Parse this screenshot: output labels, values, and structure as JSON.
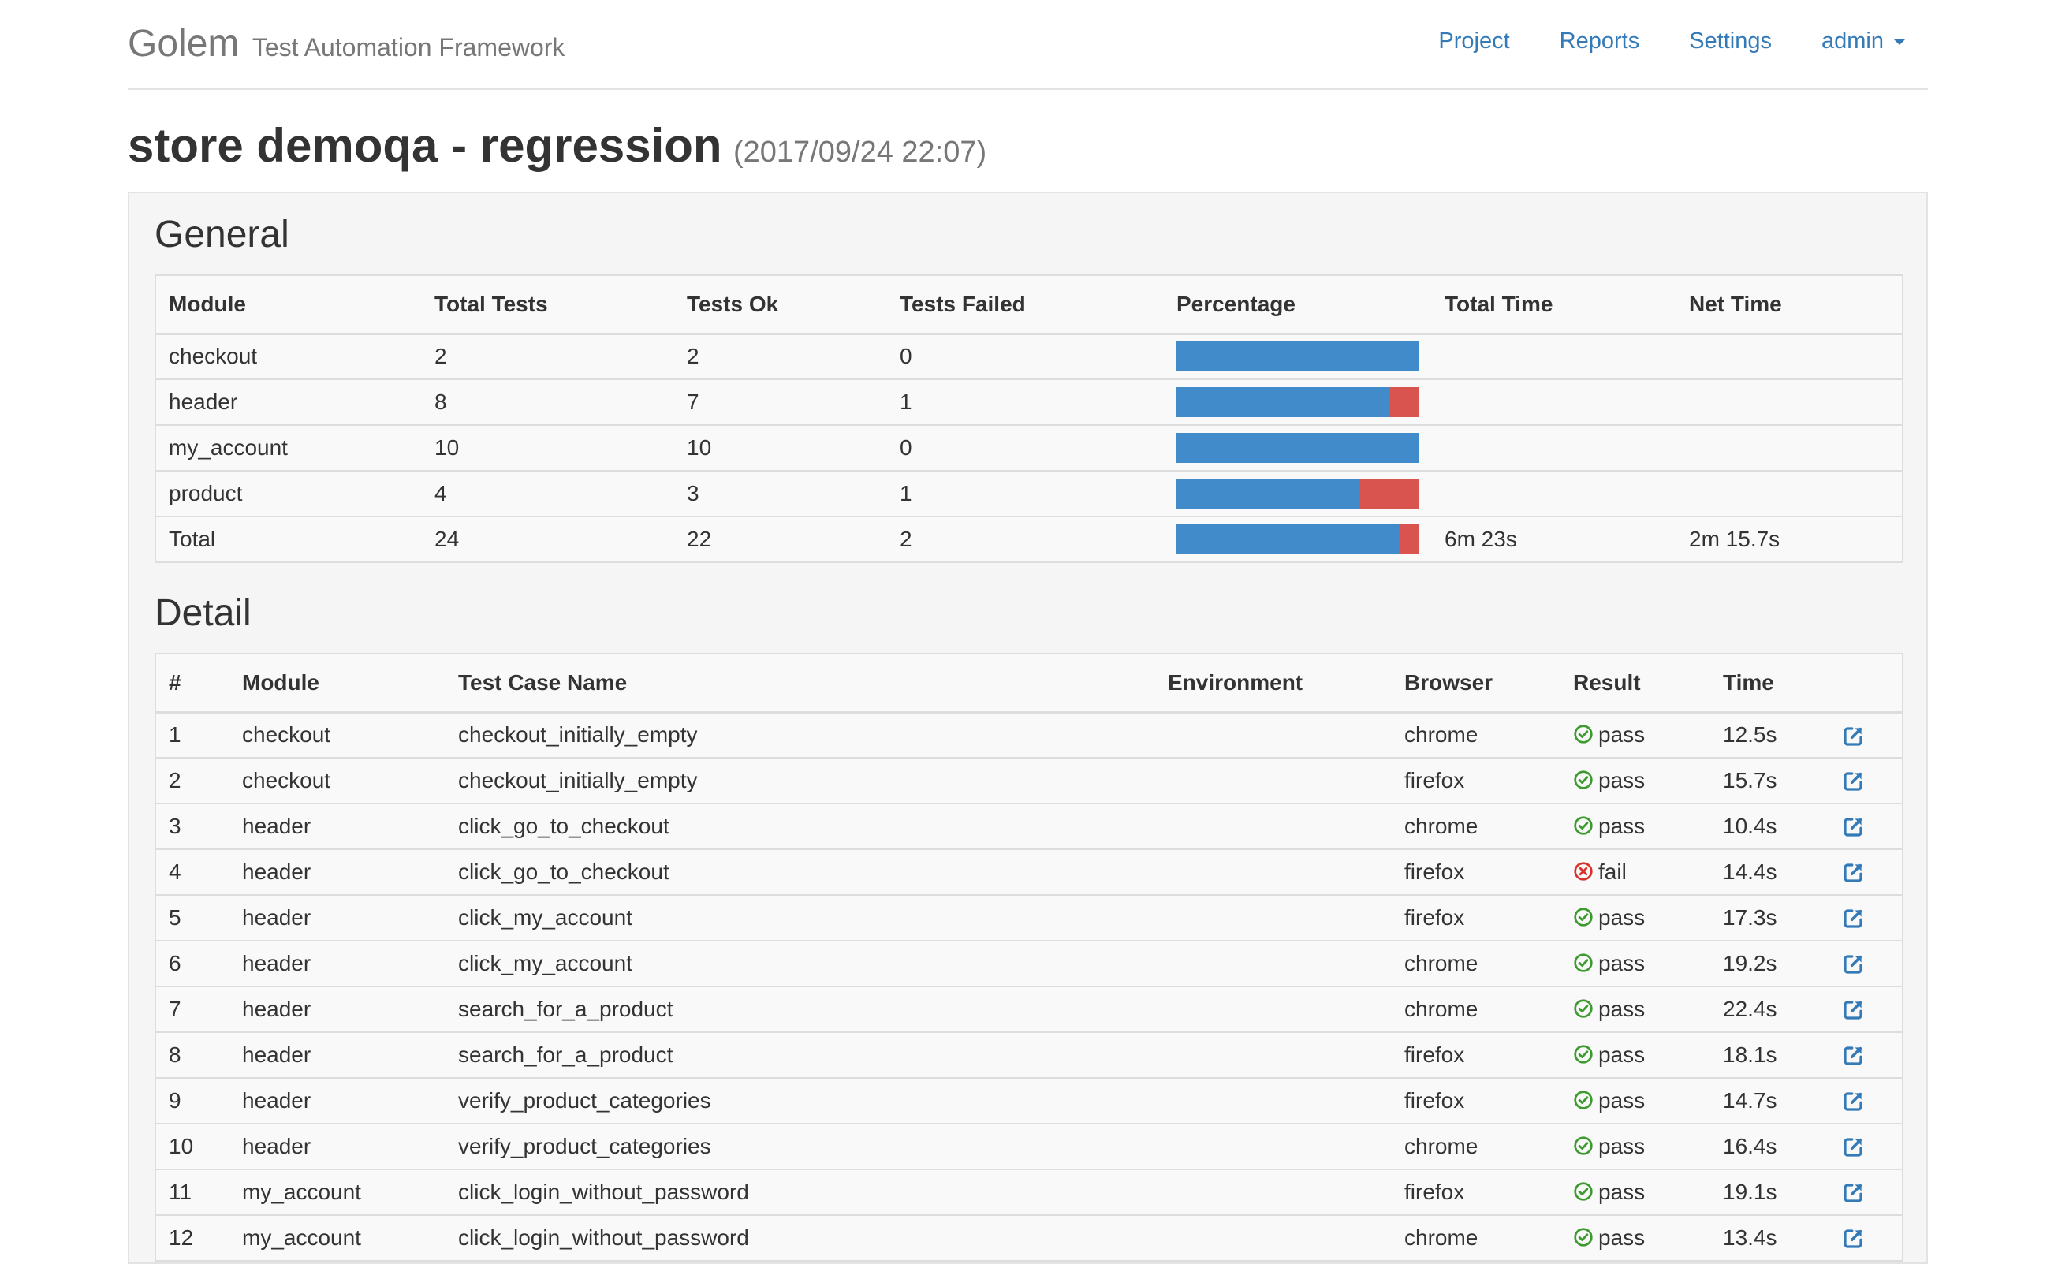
{
  "header": {
    "brand": "Golem",
    "subtitle": "Test Automation Framework",
    "nav": [
      "Project",
      "Reports",
      "Settings"
    ],
    "user": "admin"
  },
  "page": {
    "title": "store demoqa - regression",
    "timestamp": "(2017/09/24 22:07)"
  },
  "general": {
    "title": "General",
    "columns": [
      "Module",
      "Total Tests",
      "Tests Ok",
      "Tests Failed",
      "Percentage",
      "Total Time",
      "Net Time"
    ],
    "rows": [
      {
        "module": "checkout",
        "total": "2",
        "ok": "2",
        "failed": "0",
        "total_time": "",
        "net_time": ""
      },
      {
        "module": "header",
        "total": "8",
        "ok": "7",
        "failed": "1",
        "total_time": "",
        "net_time": ""
      },
      {
        "module": "my_account",
        "total": "10",
        "ok": "10",
        "failed": "0",
        "total_time": "",
        "net_time": ""
      },
      {
        "module": "product",
        "total": "4",
        "ok": "3",
        "failed": "1",
        "total_time": "",
        "net_time": ""
      },
      {
        "module": "Total",
        "total": "24",
        "ok": "22",
        "failed": "2",
        "total_time": "6m 23s",
        "net_time": "2m 15.7s"
      }
    ]
  },
  "detail": {
    "title": "Detail",
    "columns": [
      "#",
      "Module",
      "Test Case Name",
      "Environment",
      "Browser",
      "Result",
      "Time"
    ],
    "rows": [
      {
        "n": "1",
        "module": "checkout",
        "name": "checkout_initially_empty",
        "env": "",
        "browser": "chrome",
        "result": "pass",
        "time": "12.5s"
      },
      {
        "n": "2",
        "module": "checkout",
        "name": "checkout_initially_empty",
        "env": "",
        "browser": "firefox",
        "result": "pass",
        "time": "15.7s"
      },
      {
        "n": "3",
        "module": "header",
        "name": "click_go_to_checkout",
        "env": "",
        "browser": "chrome",
        "result": "pass",
        "time": "10.4s"
      },
      {
        "n": "4",
        "module": "header",
        "name": "click_go_to_checkout",
        "env": "",
        "browser": "firefox",
        "result": "fail",
        "time": "14.4s"
      },
      {
        "n": "5",
        "module": "header",
        "name": "click_my_account",
        "env": "",
        "browser": "firefox",
        "result": "pass",
        "time": "17.3s"
      },
      {
        "n": "6",
        "module": "header",
        "name": "click_my_account",
        "env": "",
        "browser": "chrome",
        "result": "pass",
        "time": "19.2s"
      },
      {
        "n": "7",
        "module": "header",
        "name": "search_for_a_product",
        "env": "",
        "browser": "chrome",
        "result": "pass",
        "time": "22.4s"
      },
      {
        "n": "8",
        "module": "header",
        "name": "search_for_a_product",
        "env": "",
        "browser": "firefox",
        "result": "pass",
        "time": "18.1s"
      },
      {
        "n": "9",
        "module": "header",
        "name": "verify_product_categories",
        "env": "",
        "browser": "firefox",
        "result": "pass",
        "time": "14.7s"
      },
      {
        "n": "10",
        "module": "header",
        "name": "verify_product_categories",
        "env": "",
        "browser": "chrome",
        "result": "pass",
        "time": "16.4s"
      },
      {
        "n": "11",
        "module": "my_account",
        "name": "click_login_without_password",
        "env": "",
        "browser": "firefox",
        "result": "pass",
        "time": "19.1s"
      },
      {
        "n": "12",
        "module": "my_account",
        "name": "click_login_without_password",
        "env": "",
        "browser": "chrome",
        "result": "pass",
        "time": "13.4s"
      }
    ]
  },
  "colors": {
    "ok": "#428bca",
    "fail": "#d9534f",
    "pass_icon": "#3c9a2e",
    "fail_icon": "#d9322c",
    "link": "#337ab7"
  },
  "icons": {
    "pass": "check-circle-icon",
    "fail": "times-circle-icon",
    "open": "external-link-icon"
  }
}
